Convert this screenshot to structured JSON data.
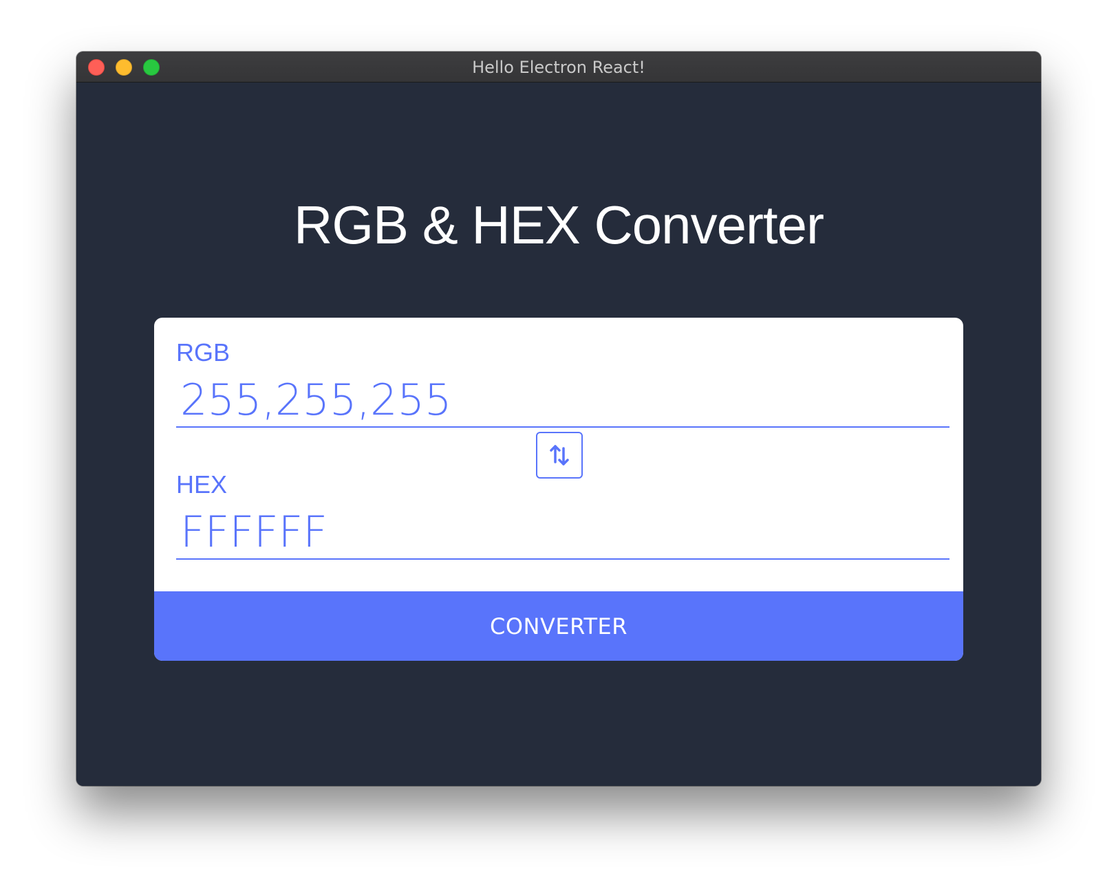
{
  "window": {
    "title": "Hello Electron React!"
  },
  "page": {
    "title": "RGB & HEX Converter"
  },
  "form": {
    "rgb": {
      "label": "RGB",
      "placeholder": "255,255,255"
    },
    "hex": {
      "label": "HEX",
      "placeholder": "FFFFFF"
    },
    "swap_icon": "swap-vertical-arrows-icon",
    "convert_label": "CONVERTER"
  },
  "colors": {
    "background": "#252c3b",
    "accent": "#5974fb",
    "card": "#ffffff",
    "title_text": "#ffffff"
  }
}
